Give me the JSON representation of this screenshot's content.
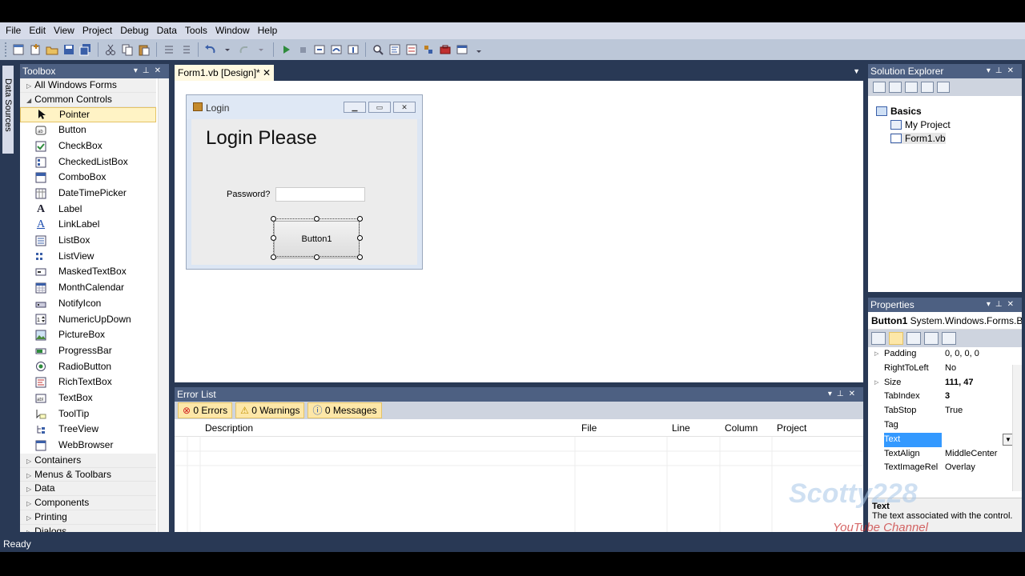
{
  "menu": [
    "File",
    "Edit",
    "View",
    "Project",
    "Debug",
    "Data",
    "Tools",
    "Window",
    "Help"
  ],
  "side_tab": {
    "label": "Data Sources"
  },
  "toolbox": {
    "title": "Toolbox",
    "categories_top": [
      {
        "label": "All Windows Forms"
      },
      {
        "label": "Common Controls"
      }
    ],
    "items": [
      {
        "label": "Pointer",
        "icon": "pointer-icon"
      },
      {
        "label": "Button",
        "icon": "button-icon"
      },
      {
        "label": "CheckBox",
        "icon": "checkbox-icon"
      },
      {
        "label": "CheckedListBox",
        "icon": "checkedlistbox-icon"
      },
      {
        "label": "ComboBox",
        "icon": "combobox-icon"
      },
      {
        "label": "DateTimePicker",
        "icon": "datetimepicker-icon"
      },
      {
        "label": "Label",
        "icon": "label-icon"
      },
      {
        "label": "LinkLabel",
        "icon": "linklabel-icon"
      },
      {
        "label": "ListBox",
        "icon": "listbox-icon"
      },
      {
        "label": "ListView",
        "icon": "listview-icon"
      },
      {
        "label": "MaskedTextBox",
        "icon": "maskedtextbox-icon"
      },
      {
        "label": "MonthCalendar",
        "icon": "monthcalendar-icon"
      },
      {
        "label": "NotifyIcon",
        "icon": "notifyicon-icon"
      },
      {
        "label": "NumericUpDown",
        "icon": "numericupdown-icon"
      },
      {
        "label": "PictureBox",
        "icon": "picturebox-icon"
      },
      {
        "label": "ProgressBar",
        "icon": "progressbar-icon"
      },
      {
        "label": "RadioButton",
        "icon": "radiobutton-icon"
      },
      {
        "label": "RichTextBox",
        "icon": "richtextbox-icon"
      },
      {
        "label": "TextBox",
        "icon": "textbox-icon"
      },
      {
        "label": "ToolTip",
        "icon": "tooltip-icon"
      },
      {
        "label": "TreeView",
        "icon": "treeview-icon"
      },
      {
        "label": "WebBrowser",
        "icon": "webbrowser-icon"
      }
    ],
    "categories_bottom": [
      {
        "label": "Containers"
      },
      {
        "label": "Menus & Toolbars"
      },
      {
        "label": "Data"
      },
      {
        "label": "Components"
      },
      {
        "label": "Printing"
      },
      {
        "label": "Dialogs"
      }
    ]
  },
  "document": {
    "tab_label": "Form1.vb [Design]*"
  },
  "form": {
    "caption": "Login",
    "heading": "Login Please",
    "password_label": "Password?",
    "button_label": "Button1"
  },
  "error_list": {
    "title": "Error List",
    "errors": "0 Errors",
    "warnings": "0 Warnings",
    "messages": "0 Messages",
    "columns": {
      "description": "Description",
      "file": "File",
      "line": "Line",
      "column": "Column",
      "project": "Project"
    }
  },
  "solution_explorer": {
    "title": "Solution Explorer",
    "solution": "Basics",
    "items": [
      "My Project",
      "Form1.vb"
    ]
  },
  "properties": {
    "title": "Properties",
    "object": "Button1",
    "object_type": "System.Windows.Forms.Button",
    "rows": [
      {
        "name": "Padding",
        "value": "0, 0, 0, 0"
      },
      {
        "name": "RightToLeft",
        "value": "No"
      },
      {
        "name": "Size",
        "value": "111, 47"
      },
      {
        "name": "TabIndex",
        "value": "3"
      },
      {
        "name": "TabStop",
        "value": "True"
      },
      {
        "name": "Tag",
        "value": ""
      },
      {
        "name": "Text",
        "value": ""
      },
      {
        "name": "TextAlign",
        "value": "MiddleCenter"
      },
      {
        "name": "TextImageRel",
        "value": "Overlay"
      }
    ],
    "desc_title": "Text",
    "desc_text": "The text associated with the control."
  },
  "status": {
    "text": "Ready"
  },
  "watermark": {
    "brand": "Scotty228",
    "tagline": "YouTube Channel"
  }
}
